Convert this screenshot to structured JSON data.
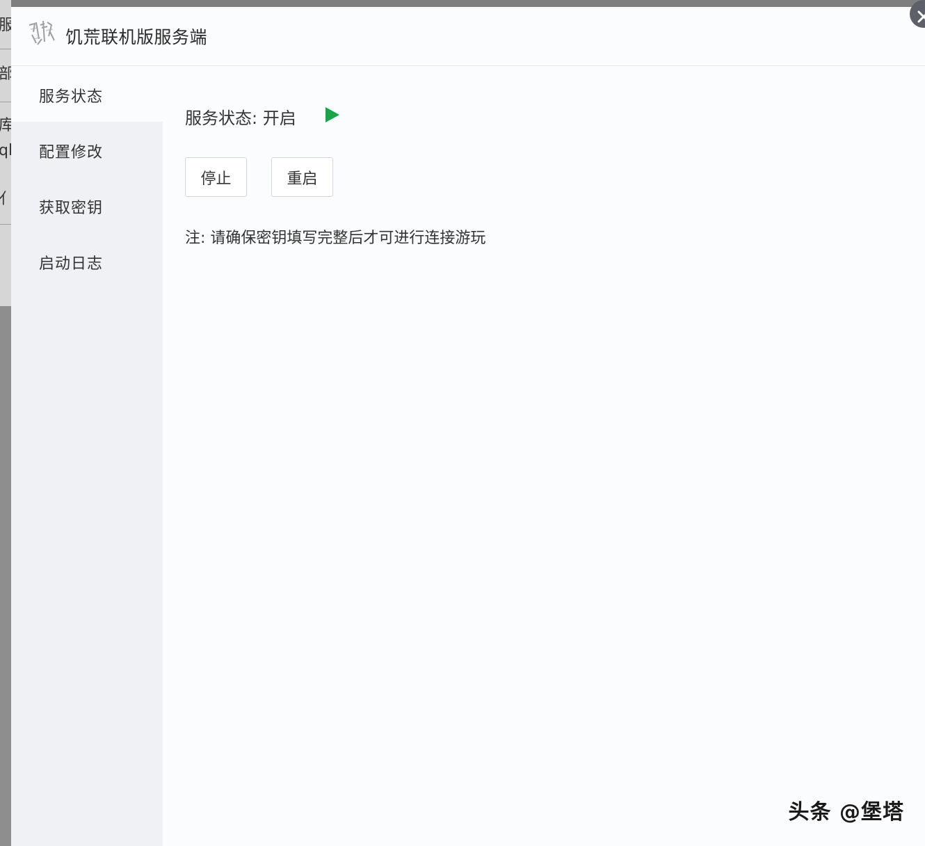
{
  "window": {
    "title": "饥荒联机版服务端",
    "logo_icon": "game-logo-icon",
    "close_icon": "close-icon"
  },
  "background_fragments": [
    "服",
    "部",
    "库",
    "ql",
    "亻"
  ],
  "sidebar": {
    "items": [
      {
        "label": "服务状态",
        "active": true
      },
      {
        "label": "配置修改",
        "active": false
      },
      {
        "label": "获取密钥",
        "active": false
      },
      {
        "label": "启动日志",
        "active": false
      }
    ]
  },
  "main": {
    "status_label": "服务状态:",
    "status_value": "开启",
    "status_icon": "play-icon",
    "status_color": "#1aa34a",
    "buttons": {
      "stop": "停止",
      "restart": "重启"
    },
    "note": "注: 请确保密钥填写完整后才可进行连接游玩"
  },
  "watermark": "头条 @堡塔"
}
